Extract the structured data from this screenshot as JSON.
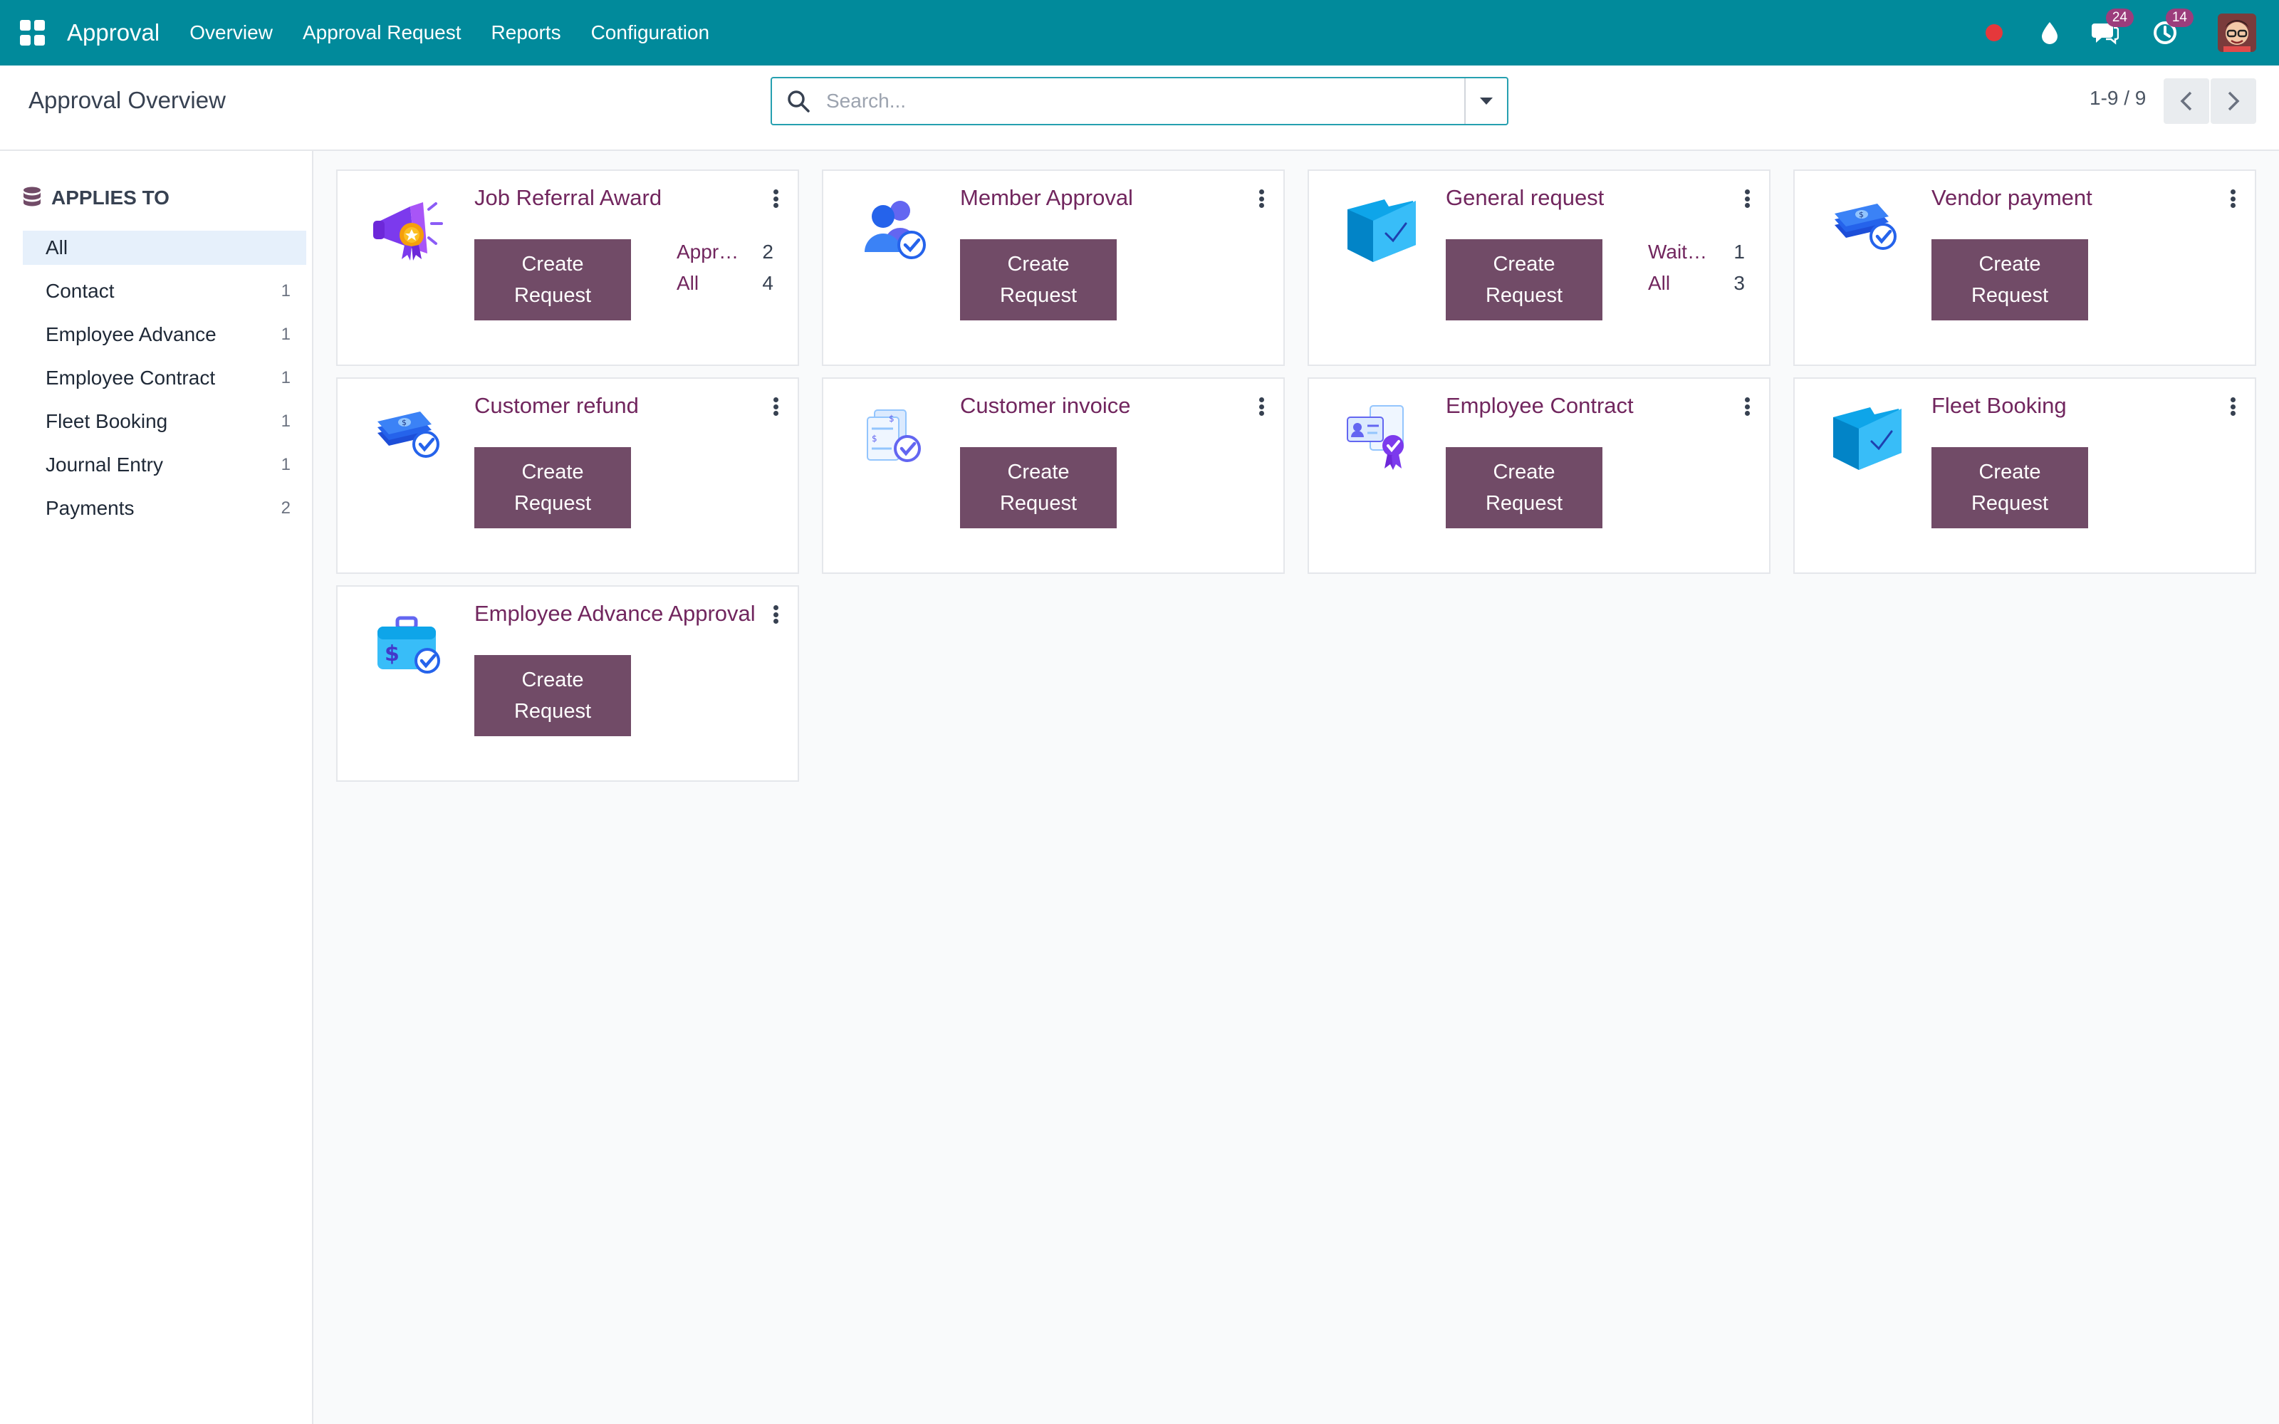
{
  "navbar": {
    "app_name": "Approval",
    "menu": [
      "Overview",
      "Approval Request",
      "Reports",
      "Configuration"
    ],
    "icons": [
      "apps-grid-icon",
      "status-dot-icon",
      "water-drop-icon",
      "chat-icon",
      "activity-clock-icon"
    ],
    "messages_badge": "24",
    "activities_badge": "14",
    "brand_color": "#018a9b",
    "status_dot_color": "#e5383b"
  },
  "control_panel": {
    "title": "Approval Overview",
    "search_placeholder": "Search...",
    "pager_value": "1-9 / 9"
  },
  "sidebar": {
    "header": "APPLIES TO",
    "items": [
      {
        "label": "All",
        "count": ""
      },
      {
        "label": "Contact",
        "count": "1"
      },
      {
        "label": "Employee Advance",
        "count": "1"
      },
      {
        "label": "Employee Contract",
        "count": "1"
      },
      {
        "label": "Fleet Booking",
        "count": "1"
      },
      {
        "label": "Journal Entry",
        "count": "1"
      },
      {
        "label": "Payments",
        "count": "2"
      }
    ]
  },
  "cards": [
    {
      "title": "Job Referral Award",
      "button": "Create Request",
      "icon": "megaphone-award-icon",
      "stats": [
        {
          "label": "Appr…",
          "value": "2"
        },
        {
          "label": "All",
          "value": "4"
        }
      ]
    },
    {
      "title": "Member Approval",
      "button": "Create Request",
      "icon": "users-check-icon",
      "stats": []
    },
    {
      "title": "General request",
      "button": "Create Request",
      "icon": "folder-check-icon",
      "stats": [
        {
          "label": "Wait…",
          "value": "1"
        },
        {
          "label": "All",
          "value": "3"
        }
      ]
    },
    {
      "title": "Vendor payment",
      "button": "Create Request",
      "icon": "money-check-icon",
      "stats": []
    },
    {
      "title": "Customer refund",
      "button": "Create Request",
      "icon": "money-check-icon",
      "stats": []
    },
    {
      "title": "Customer invoice",
      "button": "Create Request",
      "icon": "invoice-check-icon",
      "stats": []
    },
    {
      "title": "Employee Contract",
      "button": "Create Request",
      "icon": "contract-badge-icon",
      "stats": []
    },
    {
      "title": "Fleet Booking",
      "button": "Create Request",
      "icon": "folder-check-icon",
      "stats": []
    },
    {
      "title": "Employee Advance Approval",
      "button": "Create Request",
      "icon": "briefcase-money-icon",
      "stats": []
    }
  ],
  "colors": {
    "primary": "#714b67",
    "card_title": "#71265e",
    "sidebar_active": "#e6f0fb"
  }
}
